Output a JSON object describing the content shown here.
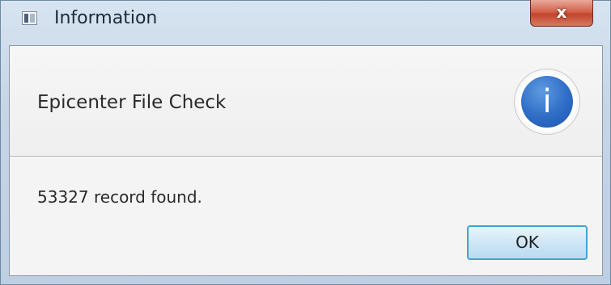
{
  "window": {
    "title": "Information",
    "close_label": "x"
  },
  "dialog": {
    "header": "Epicenter File Check",
    "message": "53327 record found.",
    "ok_label": "OK",
    "info_glyph": "i",
    "icons": {
      "window": "window-app-icon",
      "info": "information-icon"
    },
    "colors": {
      "info_blue": "#2e6cc6",
      "ok_border": "#3fa4da",
      "close_red": "#c0452d"
    }
  }
}
